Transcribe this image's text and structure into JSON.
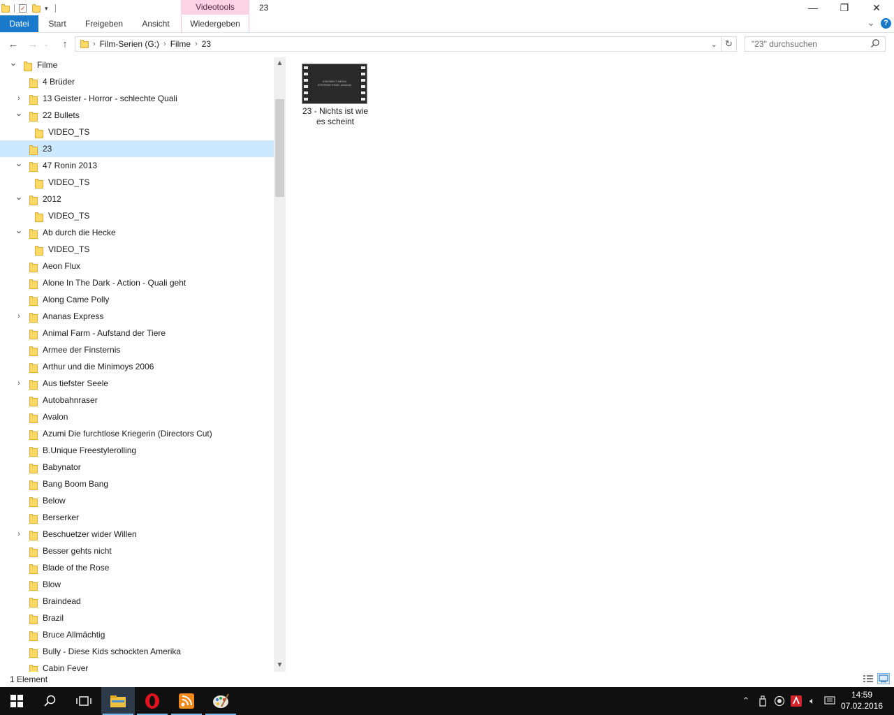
{
  "window": {
    "title": "23",
    "context_tab_header": "Videotools",
    "minimize_glyph": "—",
    "maximize_glyph": "❐",
    "close_glyph": "✕"
  },
  "ribbon": {
    "tabs": [
      "Datei",
      "Start",
      "Freigeben",
      "Ansicht",
      "Wiedergeben"
    ],
    "help_glyph": "?",
    "expand_glyph": "⌄"
  },
  "address": {
    "crumbs": [
      "Film-Serien (G:)",
      "Filme",
      "23"
    ],
    "search_placeholder": "\"23\" durchsuchen"
  },
  "tree": [
    {
      "label": "Filme",
      "level": 0,
      "expand": "open"
    },
    {
      "label": "4 Brüder",
      "level": 1,
      "expand": "none"
    },
    {
      "label": "13 Geister - Horror - schlechte Quali",
      "level": 1,
      "expand": "closed"
    },
    {
      "label": "22 Bullets",
      "level": 1,
      "expand": "open"
    },
    {
      "label": "VIDEO_TS",
      "level": 2,
      "expand": "none"
    },
    {
      "label": "23",
      "level": 1,
      "expand": "none",
      "selected": true
    },
    {
      "label": "47 Ronin 2013",
      "level": 1,
      "expand": "open"
    },
    {
      "label": "VIDEO_TS",
      "level": 2,
      "expand": "none"
    },
    {
      "label": "2012",
      "level": 1,
      "expand": "open"
    },
    {
      "label": "VIDEO_TS",
      "level": 2,
      "expand": "none"
    },
    {
      "label": "Ab durch die Hecke",
      "level": 1,
      "expand": "open"
    },
    {
      "label": "VIDEO_TS",
      "level": 2,
      "expand": "none"
    },
    {
      "label": "Aeon Flux",
      "level": 1,
      "expand": "none"
    },
    {
      "label": "Alone In The Dark - Action - Quali geht",
      "level": 1,
      "expand": "none"
    },
    {
      "label": "Along Came Polly",
      "level": 1,
      "expand": "none"
    },
    {
      "label": "Ananas Express",
      "level": 1,
      "expand": "closed"
    },
    {
      "label": "Animal Farm - Aufstand der Tiere",
      "level": 1,
      "expand": "none"
    },
    {
      "label": "Armee der Finsternis",
      "level": 1,
      "expand": "none"
    },
    {
      "label": "Arthur und die Minimoys 2006",
      "level": 1,
      "expand": "none"
    },
    {
      "label": "Aus tiefster Seele",
      "level": 1,
      "expand": "closed"
    },
    {
      "label": "Autobahnraser",
      "level": 1,
      "expand": "none"
    },
    {
      "label": "Avalon",
      "level": 1,
      "expand": "none"
    },
    {
      "label": "Azumi Die furchtlose Kriegerin (Directors Cut)",
      "level": 1,
      "expand": "none"
    },
    {
      "label": "B.Unique Freestylerolling",
      "level": 1,
      "expand": "none"
    },
    {
      "label": "Babynator",
      "level": 1,
      "expand": "none"
    },
    {
      "label": "Bang Boom Bang",
      "level": 1,
      "expand": "none"
    },
    {
      "label": "Below",
      "level": 1,
      "expand": "none"
    },
    {
      "label": "Berserker",
      "level": 1,
      "expand": "none"
    },
    {
      "label": "Beschuetzer wider Willen",
      "level": 1,
      "expand": "closed"
    },
    {
      "label": "Besser gehts nicht",
      "level": 1,
      "expand": "none"
    },
    {
      "label": "Blade of the Rose",
      "level": 1,
      "expand": "none"
    },
    {
      "label": "Blow",
      "level": 1,
      "expand": "none"
    },
    {
      "label": "Braindead",
      "level": 1,
      "expand": "none"
    },
    {
      "label": "Brazil",
      "level": 1,
      "expand": "none"
    },
    {
      "label": "Bruce Allmächtig",
      "level": 1,
      "expand": "none"
    },
    {
      "label": "Bully - Diese Kids schockten Amerika",
      "level": 1,
      "expand": "none"
    },
    {
      "label": "Cabin Fever",
      "level": 1,
      "expand": "none"
    }
  ],
  "content": {
    "file_name": "23 - Nichts ist wie es scheint",
    "thumbnail_caption": "KINOWELT MEDIA INTERNATIONAL presents"
  },
  "status": {
    "item_count": "1 Element"
  },
  "taskbar": {
    "time": "14:59",
    "date": "07.02.2016"
  },
  "colors": {
    "file_tab": "#1979ca",
    "context_tab": "#fbd3e5",
    "selection": "#cce8ff",
    "folder": "#ffd966",
    "taskbar": "#101010"
  }
}
